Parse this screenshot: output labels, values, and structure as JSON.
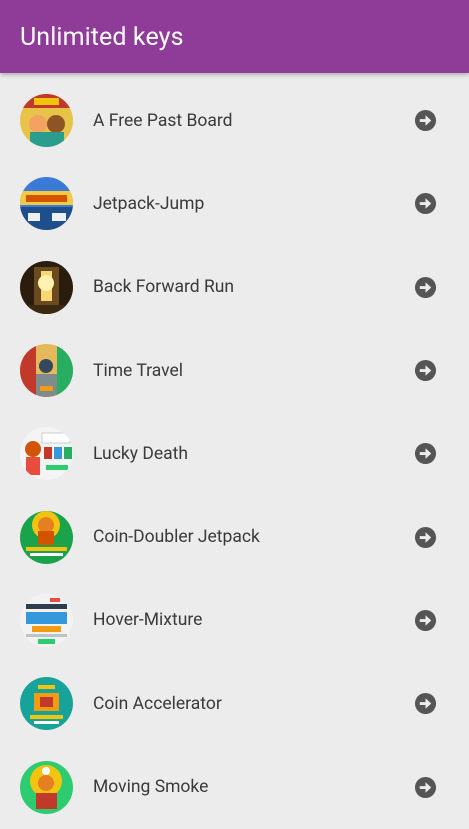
{
  "app_bar": {
    "title": "Unlimited keys"
  },
  "items": [
    {
      "label": "A Free Past Board",
      "icon": "game-thumbnail-icon"
    },
    {
      "label": "Jetpack-Jump",
      "icon": "game-thumbnail-icon"
    },
    {
      "label": "Back Forward Run",
      "icon": "game-thumbnail-icon"
    },
    {
      "label": "Time Travel",
      "icon": "game-thumbnail-icon"
    },
    {
      "label": "Lucky Death",
      "icon": "game-thumbnail-icon"
    },
    {
      "label": "Coin-Doubler Jetpack",
      "icon": "game-thumbnail-icon"
    },
    {
      "label": "Hover-Mixture",
      "icon": "game-thumbnail-icon"
    },
    {
      "label": "Coin Accelerator",
      "icon": "game-thumbnail-icon"
    },
    {
      "label": "Moving Smoke",
      "icon": "game-thumbnail-icon"
    }
  ],
  "colors": {
    "app_bar": "#8e3c98",
    "background": "#ececec",
    "arrow": "#555555"
  }
}
